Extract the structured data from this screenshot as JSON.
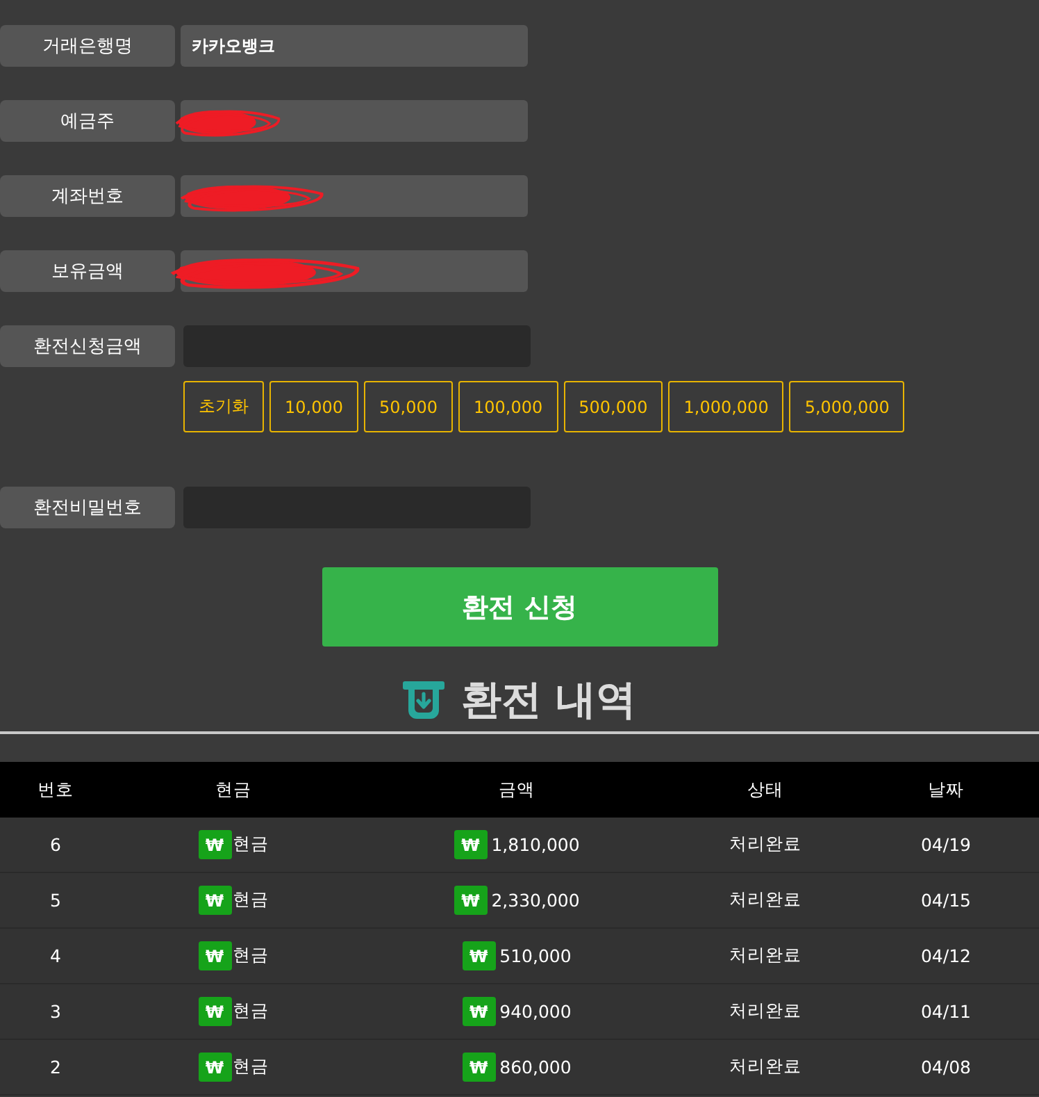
{
  "form": {
    "rows": [
      {
        "kind": "display",
        "label": "거래은행명",
        "value": "카카오뱅크",
        "redacted": false
      },
      {
        "kind": "display",
        "label": "예금주",
        "redacted": true
      },
      {
        "kind": "display",
        "label": "계좌번호",
        "redacted": true
      },
      {
        "kind": "display",
        "label": "보유금액",
        "redacted": true
      },
      {
        "kind": "input",
        "label": "환전신청금액"
      },
      {
        "kind": "presets",
        "buttons": [
          "초기화",
          "10,000",
          "50,000",
          "100,000",
          "500,000",
          "1,000,000",
          "5,000,000"
        ]
      },
      {
        "kind": "input",
        "label": "환전비밀번호"
      }
    ]
  },
  "submit_button": "환전 신청",
  "history": {
    "title": "환전 내역",
    "table": {
      "columns": [
        "번호",
        "현금",
        "금액",
        "상태",
        "날짜"
      ],
      "rows": [
        {
          "number": "6",
          "type_badge": "₩",
          "type": "현금",
          "amount_badge": "₩",
          "amount": "1,810,000",
          "status": "처리완료",
          "date": "04/19"
        },
        {
          "number": "5",
          "type_badge": "₩",
          "type": "현금",
          "amount_badge": "₩",
          "amount": "2,330,000",
          "status": "처리완료",
          "date": "04/15"
        },
        {
          "number": "4",
          "type_badge": "₩",
          "type": "현금",
          "amount_badge": "₩",
          "amount": "510,000",
          "status": "처리완료",
          "date": "04/12"
        },
        {
          "number": "3",
          "type_badge": "₩",
          "type": "현금",
          "amount_badge": "₩",
          "amount": "940,000",
          "status": "처리완료",
          "date": "04/11"
        },
        {
          "number": "2",
          "type_badge": "₩",
          "type": "현금",
          "amount_badge": "₩",
          "amount": "860,000",
          "status": "처리완료",
          "date": "04/08"
        }
      ]
    }
  }
}
